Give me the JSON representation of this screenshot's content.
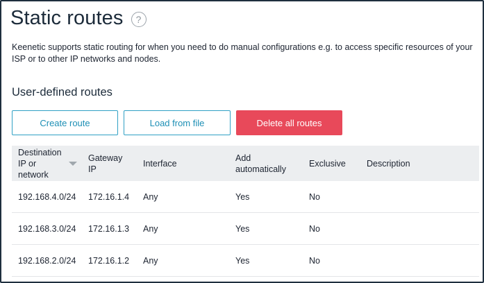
{
  "page": {
    "title": "Static routes",
    "help_symbol": "?",
    "intro": "Keenetic supports static routing for when you need to do manual configurations e.g. to access specific resources of your ISP or to other IP networks and nodes.",
    "section_title": "User-defined routes"
  },
  "buttons": {
    "create": "Create route",
    "load": "Load from file",
    "delete_all": "Delete all routes"
  },
  "colors": {
    "accent": "#2fa0c4",
    "danger": "#e8495a",
    "header_bg": "#eceef0",
    "frame": "#1f2f3e"
  },
  "table": {
    "columns": {
      "destination": [
        "Destination",
        "IP or",
        "network"
      ],
      "gateway": [
        "Gateway",
        "IP"
      ],
      "interface": [
        "Interface"
      ],
      "add_auto": [
        "Add",
        "automatically"
      ],
      "exclusive": [
        "Exclusive"
      ],
      "description": [
        "Description"
      ]
    },
    "rows": [
      {
        "destination": "192.168.4.0/24",
        "gateway": "172.16.1.4",
        "interface": "Any",
        "add_auto": "Yes",
        "exclusive": "No",
        "description": ""
      },
      {
        "destination": "192.168.3.0/24",
        "gateway": "172.16.1.3",
        "interface": "Any",
        "add_auto": "Yes",
        "exclusive": "No",
        "description": ""
      },
      {
        "destination": "192.168.2.0/24",
        "gateway": "172.16.1.2",
        "interface": "Any",
        "add_auto": "Yes",
        "exclusive": "No",
        "description": ""
      }
    ]
  }
}
